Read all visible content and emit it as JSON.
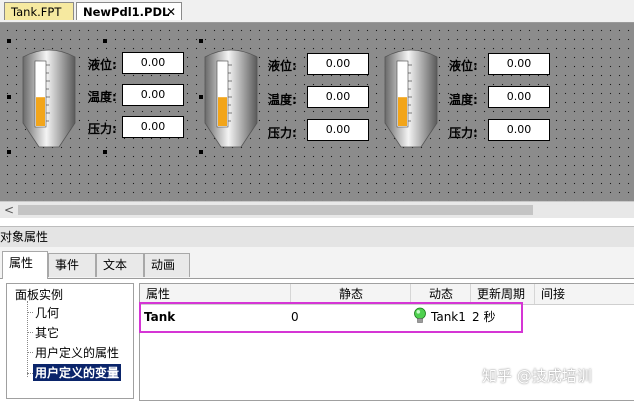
{
  "doc_tabs": [
    {
      "label": "Tank.FPT"
    },
    {
      "label": "NewPdl1.PDL",
      "close_glyph": "✕"
    }
  ],
  "canvas": {
    "tanks": [
      {
        "level_fraction": 0.45,
        "fields": [
          {
            "label": "液位:",
            "value": "0.00"
          },
          {
            "label": "温度:",
            "value": "0.00"
          },
          {
            "label": "压力:",
            "value": "0.00"
          }
        ]
      },
      {
        "level_fraction": 0.45,
        "fields": [
          {
            "label": "液位:",
            "value": "0.00"
          },
          {
            "label": "温度:",
            "value": "0.00"
          },
          {
            "label": "压力:",
            "value": "0.00"
          }
        ]
      },
      {
        "level_fraction": 0.45,
        "fields": [
          {
            "label": "液位:",
            "value": "0.00"
          },
          {
            "label": "温度:",
            "value": "0.00"
          },
          {
            "label": "压力:",
            "value": "0.00"
          }
        ]
      }
    ]
  },
  "scrollbar": {
    "left_arrow": "<"
  },
  "properties_panel": {
    "title": "对象属性",
    "tabs": [
      {
        "label": "属性",
        "active": true
      },
      {
        "label": "事件"
      },
      {
        "label": "文本"
      },
      {
        "label": "动画"
      }
    ],
    "tree": {
      "root": "面板实例",
      "children": [
        {
          "label": "几何"
        },
        {
          "label": "其它"
        },
        {
          "label": "用户定义的属性"
        },
        {
          "label": "用户定义的变量",
          "selected": true
        }
      ]
    },
    "grid": {
      "headers": [
        "属性",
        "静态",
        "动态",
        "更新周期",
        "间接"
      ],
      "rows": [
        {
          "property": "Tank",
          "static": "0",
          "dynamic": "Tank1",
          "update_cycle": "2 秒",
          "indirect": "",
          "dynamic_icon": "bulb-icon"
        }
      ]
    }
  },
  "watermark": "知乎 @技成培训",
  "colors": {
    "highlight": "#d535d5",
    "level_fill": "#f2a51a",
    "selection": "#0a246a"
  }
}
